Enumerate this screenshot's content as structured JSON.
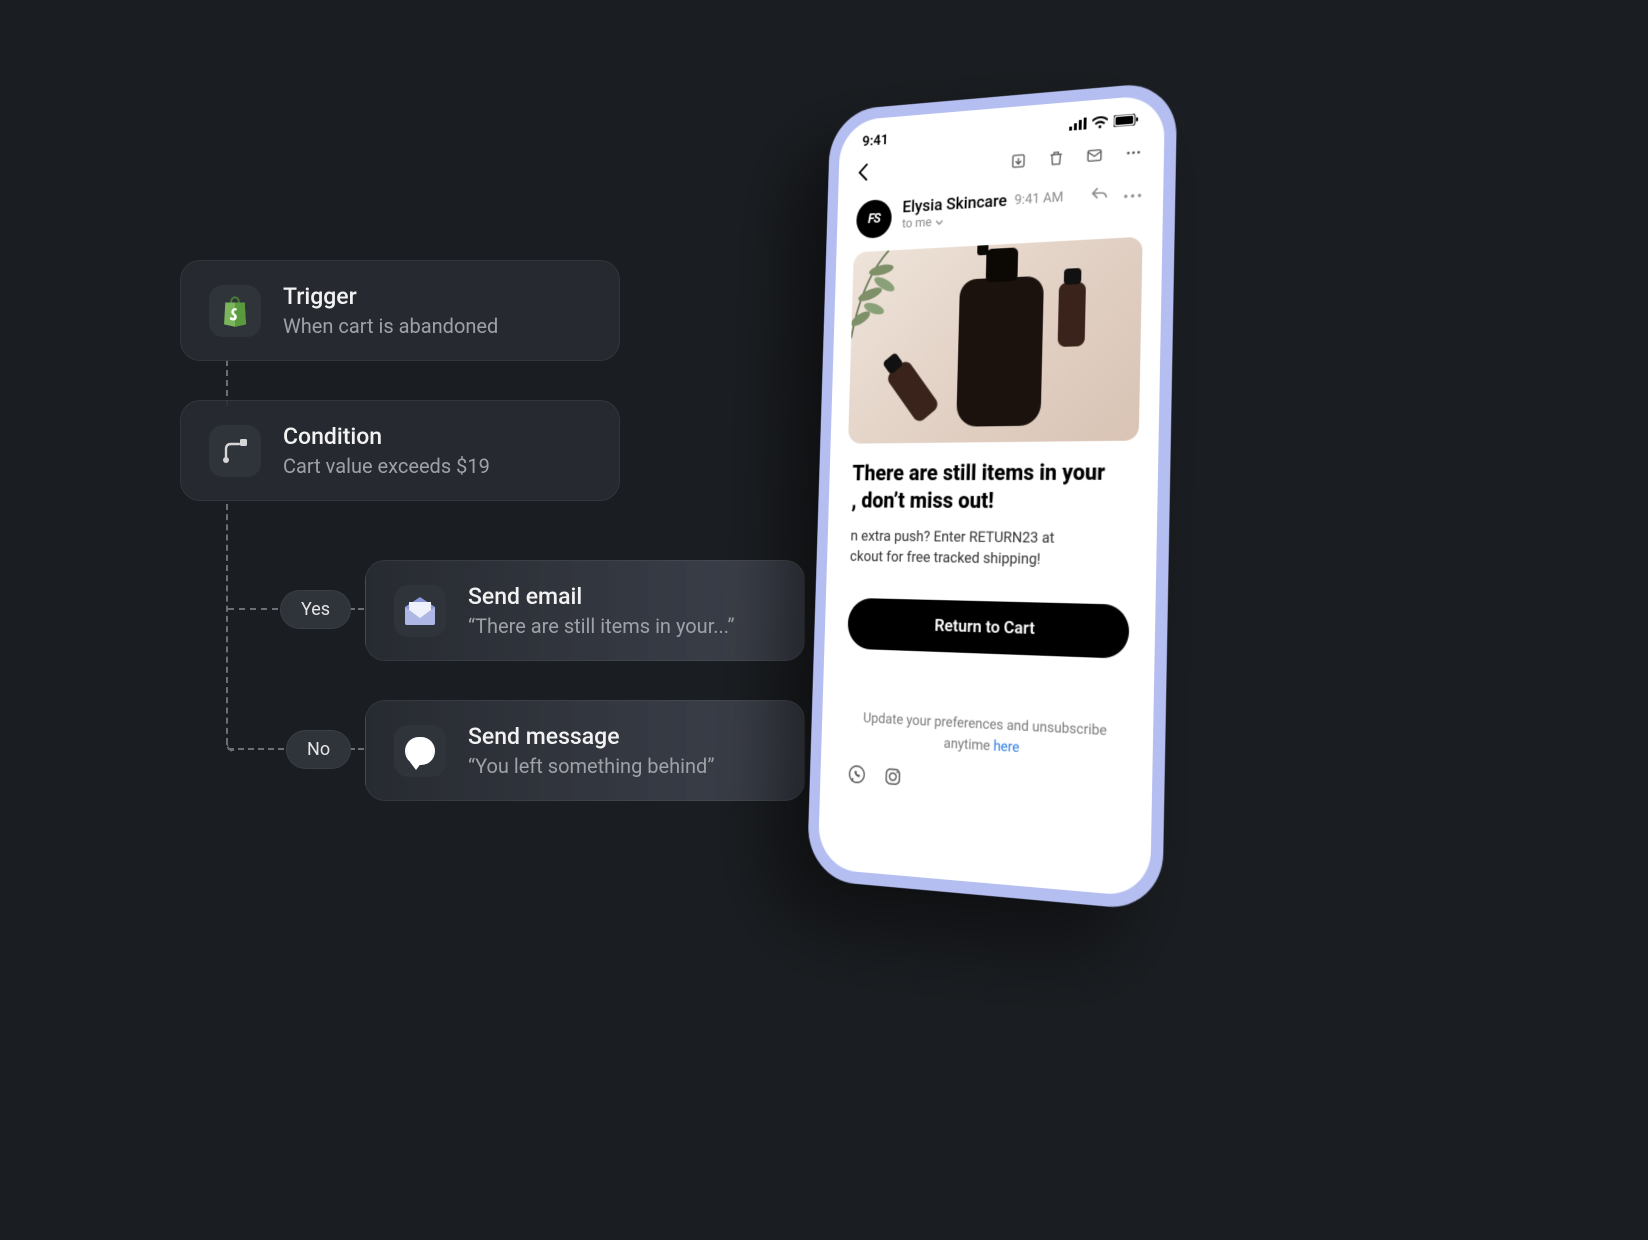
{
  "flow": {
    "trigger": {
      "title": "Trigger",
      "sub": "When cart is abandoned"
    },
    "condition": {
      "title": "Condition",
      "sub": "Cart value exceeds $19"
    },
    "email": {
      "title": "Send email",
      "sub": "“There are still items in your...”"
    },
    "message": {
      "title": "Send message",
      "sub": "“You left something behind”"
    },
    "branch_yes": "Yes",
    "branch_no": "No"
  },
  "phone": {
    "status_time": "9:41",
    "sender_name": "Elysia Skincare",
    "sender_initials": "FS",
    "sent_time": "9:41 AM",
    "to_line": "to me",
    "headline1": "There are still items in your",
    "headline2": ", don’t miss out!",
    "body1": "n extra push? Enter RETURN23 at",
    "body2": "ckout for free tracked shipping!",
    "cta": "Return to Cart",
    "footer_text": "Update your preferences and unsubscribe anytime ",
    "footer_link": "here"
  }
}
